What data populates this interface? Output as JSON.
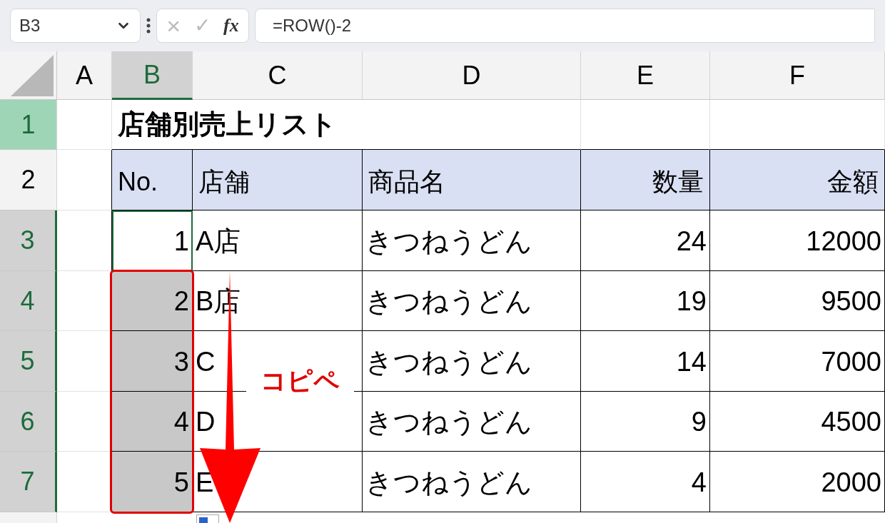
{
  "formula_bar": {
    "name_box": "B3",
    "cancel": "×",
    "enter": "✓",
    "fx": "fx",
    "formula": "=ROW()-2"
  },
  "columns": [
    {
      "label": "A",
      "selected": false
    },
    {
      "label": "B",
      "selected": true
    },
    {
      "label": "C",
      "selected": false
    },
    {
      "label": "D",
      "selected": false
    },
    {
      "label": "E",
      "selected": false
    },
    {
      "label": "F",
      "selected": false
    }
  ],
  "rows": [
    {
      "header": "1",
      "selected": false,
      "highlighted": true,
      "kind": "title",
      "title": "店舗別売上リスト"
    },
    {
      "header": "2",
      "selected": false,
      "highlighted": false,
      "kind": "table_header",
      "cells": [
        "No.",
        "店舗",
        "商品名",
        "数量",
        "金額"
      ]
    },
    {
      "header": "3",
      "selected": true,
      "highlighted": false,
      "kind": "data",
      "active": true,
      "copied": false,
      "cells": [
        "1",
        "A店",
        "きつねうどん",
        "24",
        "12000"
      ]
    },
    {
      "header": "4",
      "selected": true,
      "highlighted": false,
      "kind": "data",
      "active": false,
      "copied": true,
      "cells": [
        "2",
        "B店",
        "きつねうどん",
        "19",
        "9500"
      ]
    },
    {
      "header": "5",
      "selected": true,
      "highlighted": false,
      "kind": "data",
      "active": false,
      "copied": true,
      "cells": [
        "3",
        "C",
        "きつねうどん",
        "14",
        "7000"
      ]
    },
    {
      "header": "6",
      "selected": true,
      "highlighted": false,
      "kind": "data",
      "active": false,
      "copied": true,
      "cells": [
        "4",
        "D",
        "きつねうどん",
        "9",
        "4500"
      ]
    },
    {
      "header": "7",
      "selected": true,
      "highlighted": false,
      "kind": "data",
      "active": false,
      "copied": true,
      "cells": [
        "5",
        "E",
        "きつねうどん",
        "4",
        "2000"
      ]
    }
  ],
  "annotation": {
    "label": "コピペ"
  }
}
